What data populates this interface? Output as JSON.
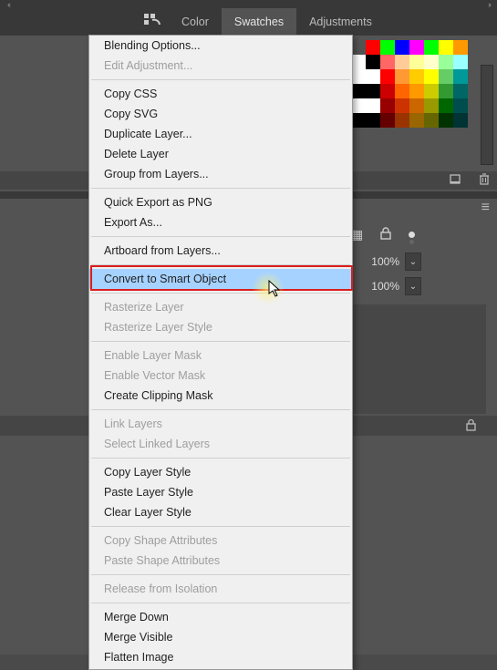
{
  "tabs": {
    "color": "Color",
    "swatches": "Swatches",
    "adjustments": "Adjustments"
  },
  "opacity": {
    "value": "100%"
  },
  "fill": {
    "value": "100%"
  },
  "swatches": {
    "row1": [
      "#ff0000",
      "#00ff00",
      "#0000ff",
      "#ff00ff",
      "#00ff00",
      "#ffff00",
      "#ff9900"
    ],
    "colors": [
      "#ffffff",
      "#000000",
      "#ff6666",
      "#ffcc99",
      "#ffff99",
      "#ffffcc",
      "#99ff99",
      "#99ffff",
      "#ffffff",
      "#ffffff",
      "#ff0000",
      "#ff9933",
      "#ffcc00",
      "#ffff00",
      "#66cc66",
      "#009999",
      "#000000",
      "#000000",
      "#cc0000",
      "#ff6600",
      "#ff9900",
      "#cccc00",
      "#339933",
      "#006666",
      "#ffffff",
      "#ffffff",
      "#990000",
      "#cc3300",
      "#cc6600",
      "#999900",
      "#006600",
      "#004d4d",
      "#000000",
      "#000000",
      "#660000",
      "#993300",
      "#996600",
      "#666600",
      "#003300",
      "#003333"
    ]
  },
  "menu": {
    "items": [
      {
        "label": "Blending Options...",
        "enabled": true
      },
      {
        "label": "Edit Adjustment...",
        "enabled": false
      },
      {
        "sep": true
      },
      {
        "label": "Copy CSS",
        "enabled": true
      },
      {
        "label": "Copy SVG",
        "enabled": true
      },
      {
        "label": "Duplicate Layer...",
        "enabled": true
      },
      {
        "label": "Delete Layer",
        "enabled": true
      },
      {
        "label": "Group from Layers...",
        "enabled": true
      },
      {
        "sep": true
      },
      {
        "label": "Quick Export as PNG",
        "enabled": true
      },
      {
        "label": "Export As...",
        "enabled": true
      },
      {
        "sep": true
      },
      {
        "label": "Artboard from Layers...",
        "enabled": true
      },
      {
        "sep": true
      },
      {
        "label": "Convert to Smart Object",
        "enabled": true,
        "highlight": true
      },
      {
        "sep": true
      },
      {
        "label": "Rasterize Layer",
        "enabled": false
      },
      {
        "label": "Rasterize Layer Style",
        "enabled": false
      },
      {
        "sep": true
      },
      {
        "label": "Enable Layer Mask",
        "enabled": false
      },
      {
        "label": "Enable Vector Mask",
        "enabled": false
      },
      {
        "label": "Create Clipping Mask",
        "enabled": true
      },
      {
        "sep": true
      },
      {
        "label": "Link Layers",
        "enabled": false
      },
      {
        "label": "Select Linked Layers",
        "enabled": false
      },
      {
        "sep": true
      },
      {
        "label": "Copy Layer Style",
        "enabled": true
      },
      {
        "label": "Paste Layer Style",
        "enabled": true
      },
      {
        "label": "Clear Layer Style",
        "enabled": true
      },
      {
        "sep": true
      },
      {
        "label": "Copy Shape Attributes",
        "enabled": false
      },
      {
        "label": "Paste Shape Attributes",
        "enabled": false
      },
      {
        "sep": true
      },
      {
        "label": "Release from Isolation",
        "enabled": false
      },
      {
        "sep": true
      },
      {
        "label": "Merge Down",
        "enabled": true
      },
      {
        "label": "Merge Visible",
        "enabled": true
      },
      {
        "label": "Flatten Image",
        "enabled": true
      }
    ]
  }
}
